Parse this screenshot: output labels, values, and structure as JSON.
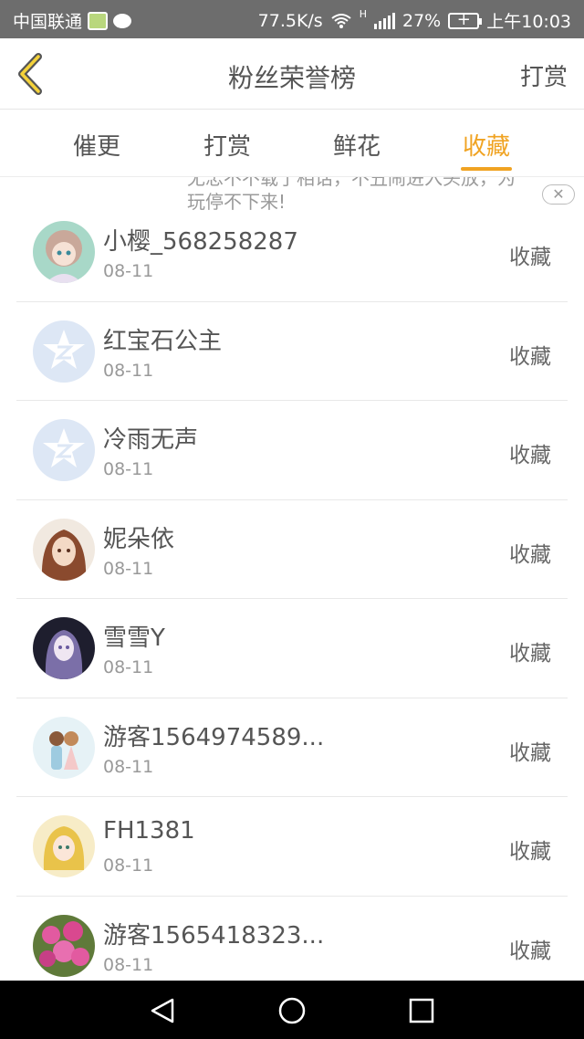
{
  "status_bar": {
    "carrier": "中国联通",
    "speed": "77.5K/s",
    "signal_h": "H",
    "battery_pct": "27%",
    "battery_glyph": "+",
    "time": "上午10:03"
  },
  "header": {
    "title": "粉丝荣誉榜",
    "action_label": "打赏"
  },
  "tabs": [
    {
      "label": "催更",
      "active": false
    },
    {
      "label": "打赏",
      "active": false
    },
    {
      "label": "鲜花",
      "active": false
    },
    {
      "label": "收藏",
      "active": true
    }
  ],
  "ad": {
    "line1": "无忠不不载了相话，不丑闹进入头放，为",
    "line2": "玩停不下来!",
    "close_glyph": "✕"
  },
  "list": [
    {
      "name": "小樱_568258287",
      "date": "08-11",
      "action": "收藏",
      "avatar": "anime-girl-avatar"
    },
    {
      "name": "红宝石公主",
      "date": "08-11",
      "action": "收藏",
      "avatar": "default-avatar"
    },
    {
      "name": "冷雨无声",
      "date": "08-11",
      "action": "收藏",
      "avatar": "default-avatar"
    },
    {
      "name": "妮朵依",
      "date": "08-11",
      "action": "收藏",
      "avatar": "portrait-avatar"
    },
    {
      "name": "雪雪Y",
      "date": "08-11",
      "action": "收藏",
      "avatar": "dark-anime-avatar"
    },
    {
      "name": "游客1564974589...",
      "date": "08-11",
      "action": "收藏",
      "avatar": "couple-avatar"
    },
    {
      "name": "FH1381",
      "date": "08-11",
      "action": "收藏",
      "avatar": "yellow-anime-avatar"
    },
    {
      "name": "游客1565418323...",
      "date": "08-11",
      "action": "收藏",
      "avatar": "flower-avatar"
    }
  ],
  "colors": {
    "accent": "#f0a322",
    "status_bar": "#6d6d6d",
    "nav_bar": "#000000",
    "default_avatar_bg": "#dde7f5"
  }
}
